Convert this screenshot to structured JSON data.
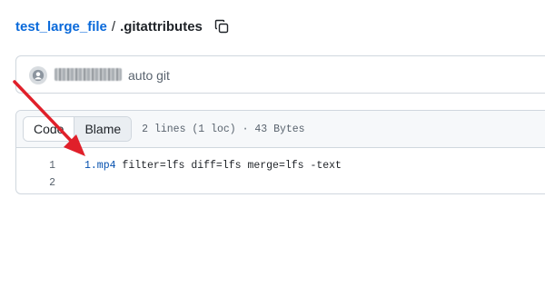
{
  "breadcrumb": {
    "repo": "test_large_file",
    "separator": "/",
    "file": ".gitattributes",
    "copy_icon": "copy-icon"
  },
  "commit": {
    "avatar_icon": "github-avatar-icon",
    "message": "auto git"
  },
  "file_view": {
    "tabs": [
      "Code",
      "Blame"
    ],
    "active_tab": "Code",
    "meta": "2 lines (1 loc) · 43 Bytes",
    "lines": [
      {
        "number": "1",
        "filename": "1.mp4",
        "rest": " filter=lfs diff=lfs merge=lfs -text"
      },
      {
        "number": "2",
        "filename": "",
        "rest": ""
      }
    ]
  },
  "colors": {
    "link": "#0969da",
    "annotation_arrow": "#e0202a",
    "border": "#d0d7de"
  }
}
